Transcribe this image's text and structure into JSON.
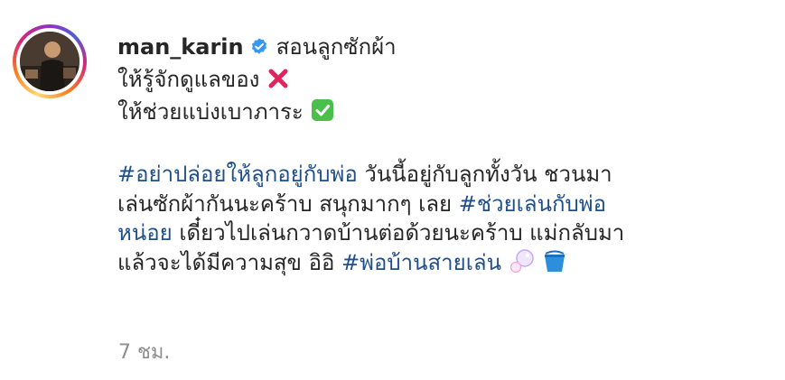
{
  "post": {
    "username": "man_karin",
    "caption_line1": "สอนลูกซักผ้า",
    "caption_line2": "ให้รู้จักดูแลของ",
    "caption_line3": "ให้ช่วยแบ่งเบาภาระ",
    "para": {
      "l1_tag": "#อย่าปล่อยให้ลูกอยู่กับพ่อ",
      "l1_text": " วันนี้อยู่กับลูกทั้งวัน ชวนมา",
      "l2_text": "เล่นซักผ้ากันนะคร้าบ สนุกมากๆ เลย ",
      "l2_tag": "#ช่วยเล่นกับพ่อ",
      "l3_tag": "หน่อย",
      "l3_text": " เดี๋ยวไปเล่นกวาดบ้านต่อด้วยนะคร้าบ แม่กลับมา",
      "l4_text": "แล้วจะได้มีความสุข อิอิ ",
      "l4_tag": "#พ่อบ้านสายเล่น"
    },
    "time": "7 ชม."
  },
  "icons": {
    "verified": "verified-badge-icon",
    "cross": "cross-mark-emoji",
    "check": "check-mark-emoji",
    "bubbles": "bubbles-emoji",
    "bucket": "bucket-emoji"
  },
  "colors": {
    "hashtag": "#1e4f8a",
    "verified": "#3897f0",
    "cross": "#e0245e",
    "check": "#4bbf4b",
    "timestamp": "#8e8e8e"
  }
}
